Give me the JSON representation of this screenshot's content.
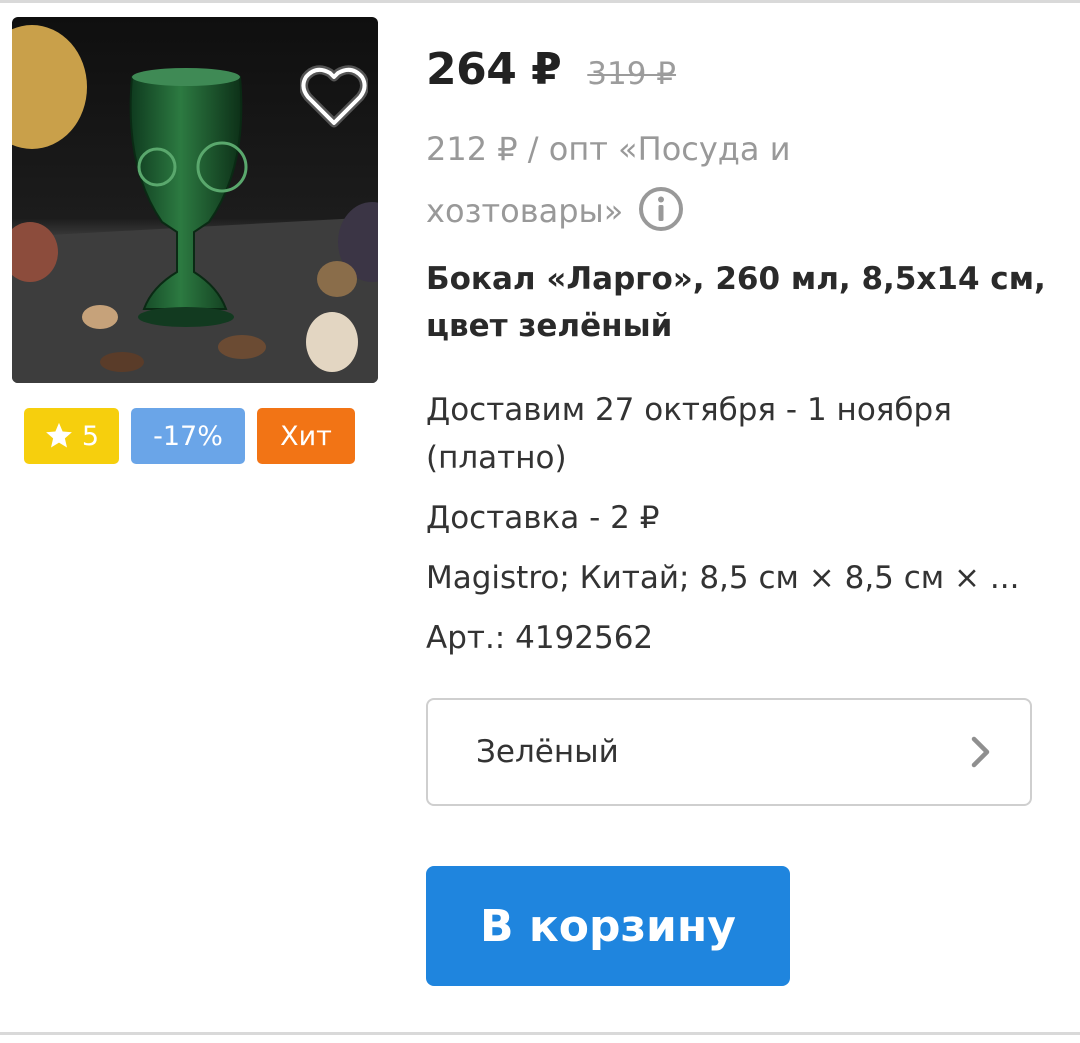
{
  "product": {
    "price_current": "264 ₽",
    "price_old": "319 ₽",
    "wholesale_text": "212 ₽ / опт «Посуда и хозтовары»",
    "title": "Бокал «Ларго», 260 мл, 8,5x14 см, цвет зелёный",
    "delivery_dates": "Доставим 27 октября - 1 ноября (платно)",
    "delivery_cost": "Доставка - 2 ₽",
    "specs": "Magistro; Китай; 8,5 см × 8,5 см × ...",
    "sku": "Арт.: 4192562"
  },
  "badges": {
    "rating": "5",
    "discount": "-17%",
    "hit": "Хит"
  },
  "color_selector": {
    "value": "Зелёный"
  },
  "cart_button": {
    "label": "В корзину"
  },
  "icons": {
    "favorite": "heart-icon",
    "info": "info-icon",
    "rating": "star-icon",
    "selector": "chevron-right-icon"
  },
  "colors": {
    "primary_button": "#1f85de",
    "rating_badge": "#f6cf0d",
    "discount_badge": "#6aa5e8",
    "hit_badge": "#f27415"
  }
}
